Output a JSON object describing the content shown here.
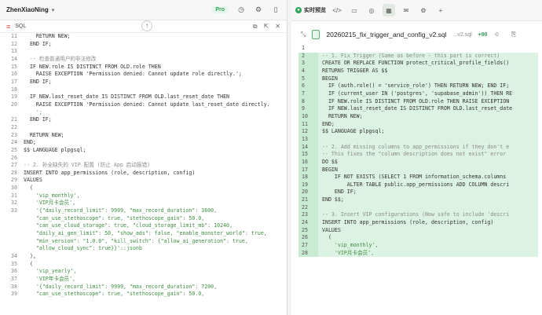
{
  "left": {
    "workspace": "ZhenXiaoNing",
    "pro_badge": "Pro",
    "lang": "SQL",
    "code_lines": [
      {
        "n": "11",
        "t": "    RETURN NEW;"
      },
      {
        "n": "12",
        "t": "  END IF;"
      },
      {
        "n": "13",
        "t": ""
      },
      {
        "n": "14",
        "t": "  -- 检查普通用户的非法修改"
      },
      {
        "n": "15",
        "t": "  IF NEW.role IS DISTINCT FROM OLD.role THEN"
      },
      {
        "n": "16",
        "t": "    RAISE EXCEPTION 'Permission denied: Cannot update role directly.';"
      },
      {
        "n": "17",
        "t": "  END IF;"
      },
      {
        "n": "18",
        "t": ""
      },
      {
        "n": "19",
        "t": "  IF NEW.last_reset_date IS DISTINCT FROM OLD.last_reset_date THEN"
      },
      {
        "n": "20",
        "t": "    RAISE EXCEPTION 'Permission denied: Cannot update last_reset_date directly."
      },
      {
        "n": "",
        "t": "    ';"
      },
      {
        "n": "21",
        "t": "  END IF;"
      },
      {
        "n": "22",
        "t": ""
      },
      {
        "n": "23",
        "t": "  RETURN NEW;"
      },
      {
        "n": "24",
        "t": "END;"
      },
      {
        "n": "25",
        "t": "$$ LANGUAGE plpgsql;"
      },
      {
        "n": "26",
        "t": ""
      },
      {
        "n": "27",
        "t": "-- 2. 补全缺失的 VIP 配置 (防止 App 启动报错)"
      },
      {
        "n": "28",
        "t": "INSERT INTO app_permissions (role, description, config)"
      },
      {
        "n": "29",
        "t": "VALUES"
      },
      {
        "n": "30",
        "t": "  ("
      },
      {
        "n": "31",
        "t": "    'vip_monthly',"
      },
      {
        "n": "32",
        "t": "    'VIP月卡会员',"
      },
      {
        "n": "33",
        "t": "    '{\"daily_record_limit\": 9999, \"max_record_duration\": 3600,"
      },
      {
        "n": "",
        "t": "    \"can_use_stethoscope\": true, \"stethoscope_gain\": 50.0,"
      },
      {
        "n": "",
        "t": "    \"can_use_cloud_storage\": true, \"cloud_storage_limit_mb\": 10240,"
      },
      {
        "n": "",
        "t": "    \"daily_ai_gen_limit\": 50, \"show_ads\": false, \"enable_monster_world\": true,"
      },
      {
        "n": "",
        "t": "    \"min_version\": \"1.0.0\", \"kill_switch\": {\"allow_ai_generation\": true,"
      },
      {
        "n": "",
        "t": "    \"allow_cloud_sync\": true}}'::jsonb"
      },
      {
        "n": "34",
        "t": "  ),"
      },
      {
        "n": "35",
        "t": "  ("
      },
      {
        "n": "36",
        "t": "    'vip_yearly',"
      },
      {
        "n": "37",
        "t": "    'VIP年卡会员',"
      },
      {
        "n": "38",
        "t": "    '{\"daily_record_limit\": 9999, \"max_record_duration\": 7200,"
      },
      {
        "n": "39",
        "t": "    \"can_use_stethoscope\": true, \"stethoscope_gain\": 50.0,"
      }
    ]
  },
  "right": {
    "preview_label": "实时预览",
    "file_name": "20260215_fix_trigger_and_config_v2.sql",
    "file_ext": "...v2.sql",
    "diff_add": "+90",
    "diff_del": "-0",
    "diff_lines": [
      {
        "n": "1",
        "t": "",
        "add": false
      },
      {
        "n": "2",
        "t": "-- 1. Fix Trigger (Same as before - this part is correct)",
        "add": true
      },
      {
        "n": "3",
        "t": "CREATE OR REPLACE FUNCTION protect_critical_profile_fields()",
        "add": true
      },
      {
        "n": "4",
        "t": "RETURNS TRIGGER AS $$",
        "add": true
      },
      {
        "n": "5",
        "t": "BEGIN",
        "add": true
      },
      {
        "n": "6",
        "t": "  IF (auth.role() = 'service_role') THEN RETURN NEW; END IF;",
        "add": true
      },
      {
        "n": "7",
        "t": "  IF (current_user IN ('postgres', 'supabase_admin')) THEN RE",
        "add": true
      },
      {
        "n": "8",
        "t": "  IF NEW.role IS DISTINCT FROM OLD.role THEN RAISE EXCEPTION",
        "add": true
      },
      {
        "n": "9",
        "t": "  IF NEW.last_reset_date IS DISTINCT FROM OLD.last_reset_date",
        "add": true
      },
      {
        "n": "10",
        "t": "  RETURN NEW;",
        "add": true
      },
      {
        "n": "11",
        "t": "END;",
        "add": true
      },
      {
        "n": "12",
        "t": "$$ LANGUAGE plpgsql;",
        "add": true
      },
      {
        "n": "13",
        "t": "",
        "add": true
      },
      {
        "n": "14",
        "t": "-- 2. Add missing columns to app_permissions if they don't e",
        "add": true
      },
      {
        "n": "15",
        "t": "-- This fixes the \"column description does not exist\" error",
        "add": true
      },
      {
        "n": "16",
        "t": "DO $$",
        "add": true
      },
      {
        "n": "17",
        "t": "BEGIN",
        "add": true
      },
      {
        "n": "18",
        "t": "    IF NOT EXISTS (SELECT 1 FROM information_schema.columns",
        "add": true
      },
      {
        "n": "19",
        "t": "        ALTER TABLE public.app_permissions ADD COLUMN descri",
        "add": true
      },
      {
        "n": "20",
        "t": "    END IF;",
        "add": true
      },
      {
        "n": "21",
        "t": "END $$;",
        "add": true
      },
      {
        "n": "22",
        "t": "",
        "add": true
      },
      {
        "n": "23",
        "t": "-- 3. Insert VIP configurations (Now safe to include 'descri",
        "add": true
      },
      {
        "n": "24",
        "t": "INSERT INTO app_permissions (role, description, config)",
        "add": true
      },
      {
        "n": "25",
        "t": "VALUES",
        "add": true
      },
      {
        "n": "26",
        "t": "  (",
        "add": true
      },
      {
        "n": "27",
        "t": "    'vip_monthly',",
        "add": true
      },
      {
        "n": "28",
        "t": "    'VIP月卡会员',",
        "add": true
      }
    ]
  }
}
